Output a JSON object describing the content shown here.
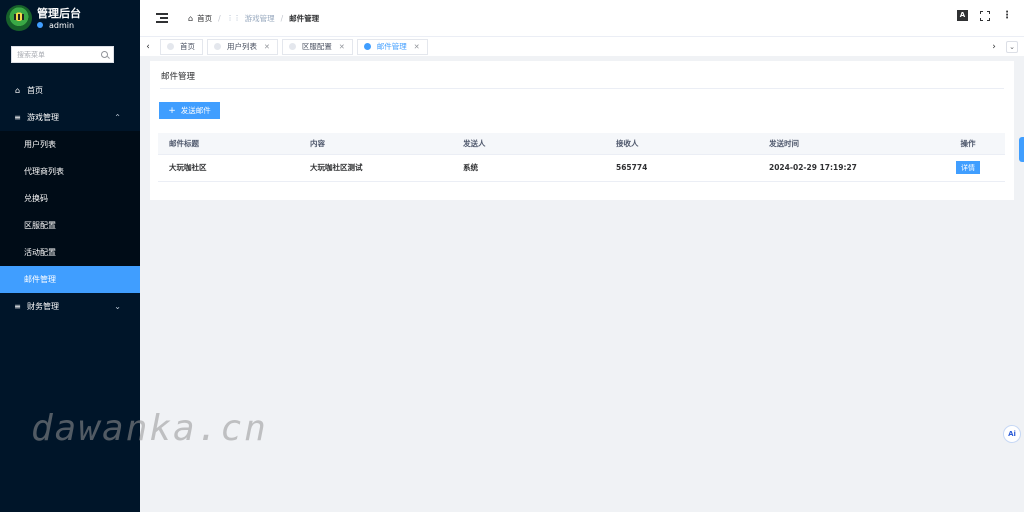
{
  "sidebar": {
    "title": "管理后台",
    "user": "admin",
    "search_placeholder": "搜索菜单",
    "items": [
      {
        "label": "首页",
        "icon": "home-icon"
      },
      {
        "label": "游戏管理",
        "icon": "list-icon",
        "expanded": true,
        "children": [
          {
            "label": "用户列表"
          },
          {
            "label": "代理商列表"
          },
          {
            "label": "兑换码"
          },
          {
            "label": "区服配置"
          },
          {
            "label": "活动配置"
          },
          {
            "label": "邮件管理",
            "active": true
          }
        ]
      },
      {
        "label": "财务管理",
        "icon": "list-icon",
        "expanded": false
      }
    ]
  },
  "header": {
    "breadcrumb": [
      "首页",
      "游戏管理",
      "邮件管理"
    ],
    "font_icon_label": "A"
  },
  "tabs": [
    {
      "label": "首页",
      "active": false,
      "closable": false
    },
    {
      "label": "用户列表",
      "active": false,
      "closable": true
    },
    {
      "label": "区服配置",
      "active": false,
      "closable": true
    },
    {
      "label": "邮件管理",
      "active": true,
      "closable": true
    }
  ],
  "main": {
    "title": "邮件管理",
    "send_button": "发送邮件",
    "table": {
      "columns": [
        "邮件标题",
        "内容",
        "发送人",
        "接收人",
        "发送时间",
        "操作"
      ],
      "rows": [
        {
          "title": "大玩咖社区",
          "content": "大玩咖社区测试",
          "sender": "系统",
          "receiver": "565774",
          "time": "2024-02-29 17:19:27",
          "action": "详情"
        }
      ]
    }
  },
  "watermark": "dawanka.cn",
  "ai_badge": "Ai",
  "colors": {
    "primary": "#409eff",
    "sidebar_bg": "#001529",
    "submenu_bg": "#000c17"
  }
}
